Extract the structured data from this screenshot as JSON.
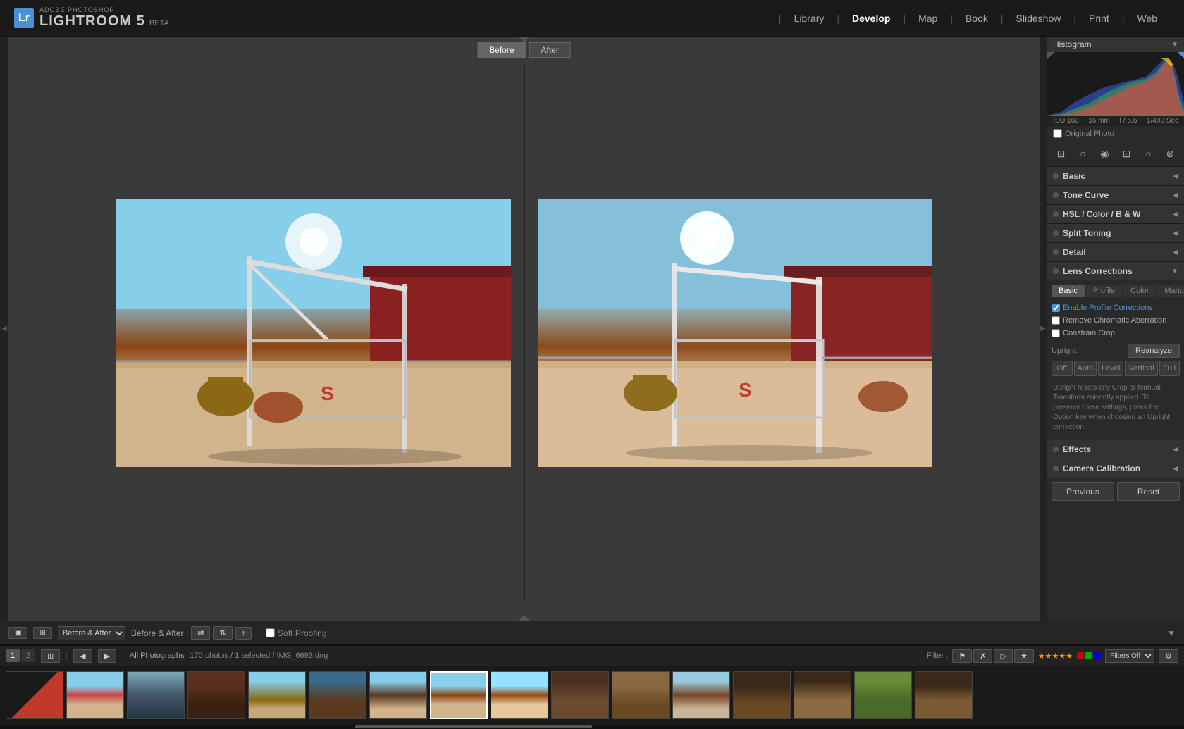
{
  "app": {
    "subtitle": "ADOBE PHOTOSHOP",
    "title": "LIGHTROOM 5",
    "beta": "BETA"
  },
  "nav": {
    "links": [
      "Library",
      "Develop",
      "Map",
      "Book",
      "Slideshow",
      "Print",
      "Web"
    ],
    "active": "Develop"
  },
  "before_after": {
    "before_label": "Before",
    "after_label": "After"
  },
  "histogram": {
    "title": "Histogram",
    "iso": "ISO 160",
    "focal": "16 mm",
    "aperture": "f / 5.6",
    "shutter": "1/400 Sec",
    "original_photo": "Original Photo"
  },
  "panels": {
    "basic": "Basic",
    "tone_curve": "Tone Curve",
    "hsl_color_bw": "HSL / Color / B & W",
    "split_toning": "Split Toning",
    "detail": "Detail",
    "lens_corrections": "Lens Corrections",
    "effects": "Effects",
    "camera_calibration": "Camera Calibration"
  },
  "lens_corrections": {
    "tabs": [
      "Basic",
      "Profile",
      "Color",
      "Manual"
    ],
    "active_tab": "Basic",
    "enable_profile": "Enable Profile Corrections",
    "remove_chromatic": "Remove Chromatic Aberration",
    "constrain_crop": "Constrain Crop",
    "upright_label": "Upright",
    "reanalyze": "Reanalyze",
    "off": "Off",
    "auto": "Auto",
    "level": "Level",
    "vertical": "Vertical",
    "full": "Full",
    "note": "Upright resets any Crop or Manual Transform currently applied. To preserve these settings, press the Option key when choosing an Upright correction."
  },
  "bottom_toolbar": {
    "before_after_label": "Before & After :",
    "soft_proofing": "Soft Proofing"
  },
  "action_buttons": {
    "previous": "Previous",
    "reset": "Reset"
  },
  "filmstrip": {
    "page1": "1",
    "page2": "2",
    "source": "All Photographs",
    "count": "170 photos / 1 selected / IMG_6693.dng",
    "filter_label": "Filter :",
    "filters_off": "Filters Off"
  }
}
